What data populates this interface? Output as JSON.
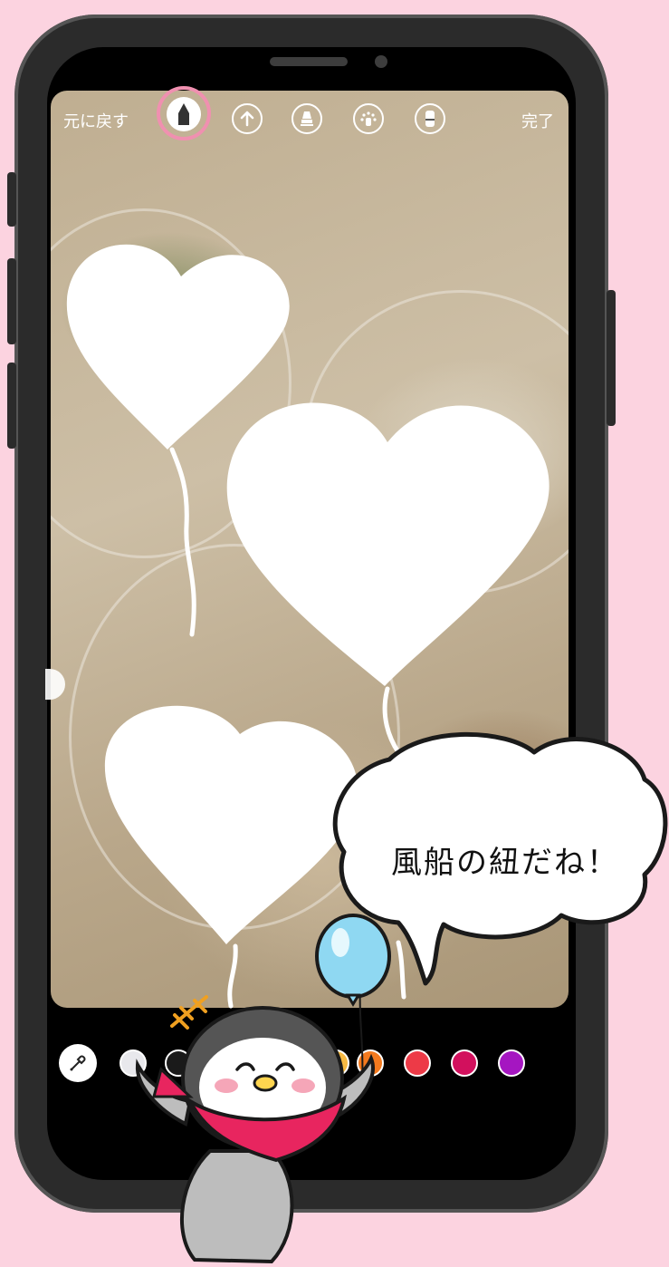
{
  "toolbar": {
    "undo_label": "元に戻す",
    "done_label": "完了",
    "tools": [
      {
        "icon": "pen-icon",
        "selected": true
      },
      {
        "icon": "arrow-up-icon",
        "selected": false
      },
      {
        "icon": "marker-icon",
        "selected": false
      },
      {
        "icon": "glow-brush-icon",
        "selected": false
      },
      {
        "icon": "eraser-icon",
        "selected": false
      }
    ]
  },
  "palette": {
    "eyedropper_icon": "eyedropper-icon",
    "colors": [
      "#e8e8ec",
      "#1a1a1a",
      "#f6b942",
      "#f47a1e",
      "#ed3a47",
      "#d2105d",
      "#a516c1"
    ]
  },
  "drawing": {
    "stroke_color": "#ffffff",
    "shapes": [
      "heart-balloon",
      "heart-balloon",
      "heart-balloon"
    ]
  },
  "speech_bubble": {
    "text": "風船の紐だね！"
  },
  "mascot": {
    "icon": "penguin-with-balloon-icon",
    "balloon_color": "#8fd8f2",
    "scarf_color": "#e8255f"
  },
  "colors": {
    "background": "#fcd3e0",
    "phone_frame": "#2b2b2b",
    "selected_ring": "#f090b0"
  }
}
